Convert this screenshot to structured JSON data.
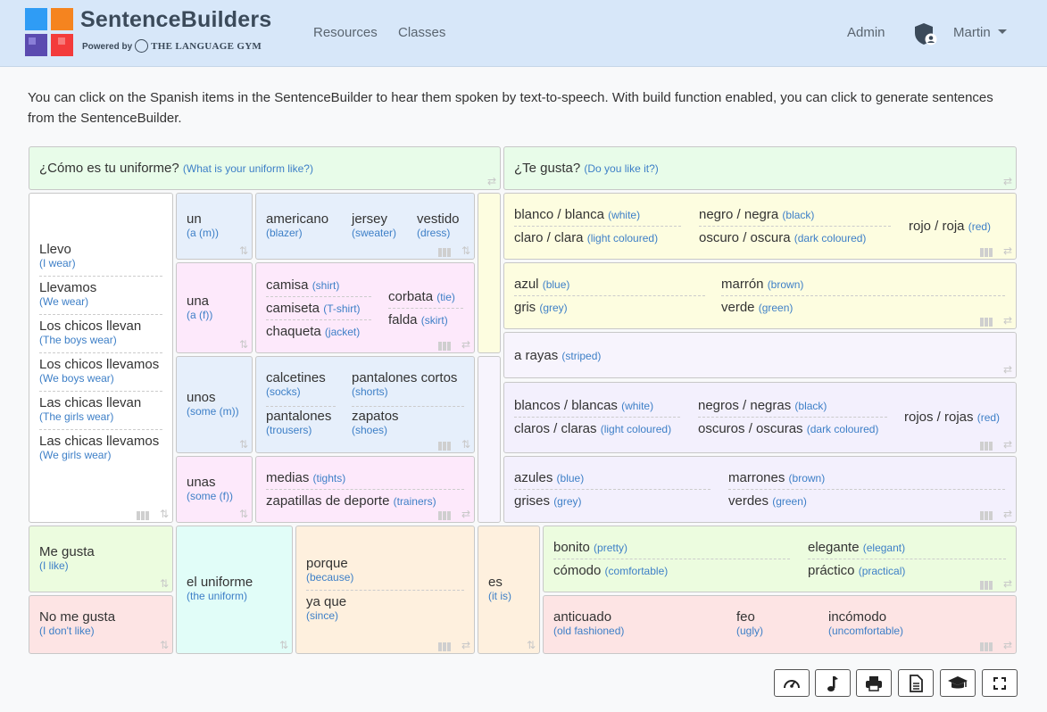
{
  "brand": {
    "title": "SentenceBuilders",
    "powered": "Powered by",
    "gym": "THE LANGUAGE GYM"
  },
  "nav": {
    "resources": "Resources",
    "classes": "Classes",
    "admin": "Admin",
    "user": "Martin"
  },
  "intro": "You can click on the Spanish items in the SentenceBuilder to hear them spoken by text-to-speech. With build function enabled, you can click to generate sentences from the SentenceBuilder.",
  "q1": {
    "es": "¿Cómo es tu uniforme?",
    "en": "(What is your uniform like?)"
  },
  "q2": {
    "es": "¿Te gusta?",
    "en": "(Do you like it?)"
  },
  "subjects": [
    {
      "es": "Llevo",
      "en": "(I wear)"
    },
    {
      "es": "Llevamos",
      "en": "(We wear)"
    },
    {
      "es": "Los chicos llevan",
      "en": "(The boys wear)"
    },
    {
      "es": "Los chicos llevamos",
      "en": "(We boys wear)"
    },
    {
      "es": "Las chicas llevan",
      "en": "(The girls wear)"
    },
    {
      "es": "Las chicas llevamos",
      "en": "(We girls wear)"
    }
  ],
  "articles": {
    "un": {
      "es": "un",
      "en": "(a (m))"
    },
    "una": {
      "es": "una",
      "en": "(a (f))"
    },
    "unos": {
      "es": "unos",
      "en": "(some (m))"
    },
    "unas": {
      "es": "unas",
      "en": "(some (f))"
    }
  },
  "nouns": {
    "m": [
      {
        "es": "americano",
        "en": "(blazer)"
      },
      {
        "es": "jersey",
        "en": "(sweater)"
      },
      {
        "es": "vestido",
        "en": "(dress)"
      }
    ],
    "f": [
      {
        "es": "camisa",
        "en": "(shirt)"
      },
      {
        "es": "camiseta",
        "en": "(T-shirt)"
      },
      {
        "es": "chaqueta",
        "en": "(jacket)"
      },
      {
        "es": "corbata",
        "en": "(tie)"
      },
      {
        "es": "falda",
        "en": "(skirt)"
      }
    ],
    "mp": [
      {
        "es": "calcetines",
        "en": "(socks)"
      },
      {
        "es": "pantalones cortos",
        "en": "(shorts)"
      },
      {
        "es": "pantalones",
        "en": "(trousers)"
      },
      {
        "es": "zapatos",
        "en": "(shoes)"
      }
    ],
    "fp": [
      {
        "es": "medias",
        "en": "(tights)"
      },
      {
        "es": "zapatillas de deporte",
        "en": "(trainers)"
      }
    ]
  },
  "colors": {
    "y1": [
      {
        "es": "blanco / blanca",
        "en": "(white)"
      },
      {
        "es": "claro / clara",
        "en": "(light coloured)"
      },
      {
        "es": "negro / negra",
        "en": "(black)"
      },
      {
        "es": "oscuro / oscura",
        "en": "(dark coloured)"
      },
      {
        "es": "rojo / roja",
        "en": "(red)"
      }
    ],
    "y2": [
      {
        "es": "azul",
        "en": "(blue)"
      },
      {
        "es": "gris",
        "en": "(grey)"
      },
      {
        "es": "marrón",
        "en": "(brown)"
      },
      {
        "es": "verde",
        "en": "(green)"
      }
    ],
    "stripe": {
      "es": "a rayas",
      "en": "(striped)"
    },
    "l1": [
      {
        "es": "blancos / blancas",
        "en": "(white)"
      },
      {
        "es": "claros / claras",
        "en": "(light coloured)"
      },
      {
        "es": "negros / negras",
        "en": "(black)"
      },
      {
        "es": "oscuros / oscuras",
        "en": "(dark coloured)"
      },
      {
        "es": "rojos / rojas",
        "en": "(red)"
      }
    ],
    "l2": [
      {
        "es": "azules",
        "en": "(blue)"
      },
      {
        "es": "grises",
        "en": "(grey)"
      },
      {
        "es": "marrones",
        "en": "(brown)"
      },
      {
        "es": "verdes",
        "en": "(green)"
      }
    ]
  },
  "opinion": {
    "like": {
      "es": "Me gusta",
      "en": "(I like)"
    },
    "dislike": {
      "es": "No me gusta",
      "en": "(I don't like)"
    },
    "uniform": {
      "es": "el uniforme",
      "en": "(the uniform)"
    },
    "porque": {
      "es": "porque",
      "en": "(because)"
    },
    "yaque": {
      "es": "ya que",
      "en": "(since)"
    },
    "es": {
      "es": "es",
      "en": "(it is)"
    },
    "pos": [
      {
        "es": "bonito",
        "en": "(pretty)"
      },
      {
        "es": "cómodo",
        "en": "(comfortable)"
      },
      {
        "es": "elegante",
        "en": "(elegant)"
      },
      {
        "es": "práctico",
        "en": "(practical)"
      }
    ],
    "neg": [
      {
        "es": "anticuado",
        "en": "(old fashioned)"
      },
      {
        "es": "feo",
        "en": "(ugly)"
      },
      {
        "es": "incómodo",
        "en": "(uncomfortable)"
      }
    ]
  },
  "toolbar": [
    "speedometer-icon",
    "music-note-icon",
    "printer-icon",
    "document-icon",
    "graduation-cap-icon",
    "fullscreen-icon"
  ],
  "palette": {
    "accent": "#3d7fc7",
    "navbar": "#d7e7f9"
  }
}
